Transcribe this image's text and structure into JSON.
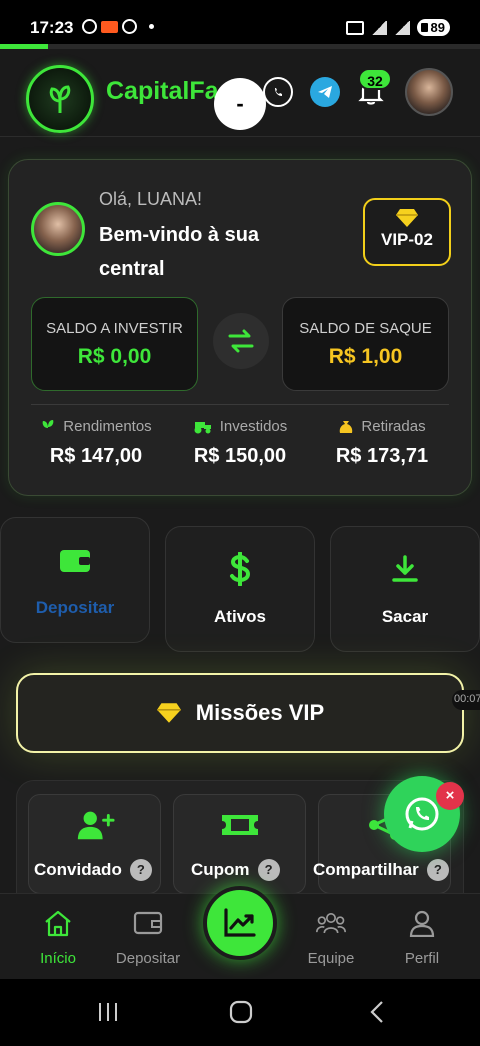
{
  "status_bar": {
    "time": "17:23",
    "battery": "89"
  },
  "loading": {
    "progress": 0.1
  },
  "header": {
    "brand": "CapitalFa",
    "notification_count": "32",
    "cursor_glyph": "-"
  },
  "welcome": {
    "greeting": "Olá, LUANA!",
    "title": "Bem-vindo à sua central",
    "vip_level": "VIP-02",
    "balances": {
      "invest_label": "SALDO A INVESTIR",
      "invest_value": "R$ 0,00",
      "saque_label": "SALDO DE SAQUE",
      "saque_value": "R$ 1,00"
    },
    "stats": [
      {
        "label": "Rendimentos",
        "value": "R$ 147,00",
        "icon": "sprout-icon"
      },
      {
        "label": "Investidos",
        "value": "R$ 150,00",
        "icon": "tractor-icon"
      },
      {
        "label": "Retiradas",
        "value": "R$ 173,71",
        "icon": "money-bag-icon"
      }
    ]
  },
  "actions": [
    {
      "label": "Depositar",
      "icon": "wallet-icon"
    },
    {
      "label": "Ativos",
      "icon": "dollar-icon"
    },
    {
      "label": "Sacar",
      "icon": "download-icon"
    }
  ],
  "missions": {
    "label": "Missões VIP",
    "edge_time": "00:07"
  },
  "mini_cards": [
    {
      "label": "Convidado",
      "icon": "add-user-icon"
    },
    {
      "label": "Cupom",
      "icon": "ticket-icon"
    },
    {
      "label": "Compartilhar",
      "icon": "share-icon"
    }
  ],
  "help_glyph": "?",
  "whatsapp_float": {
    "close_glyph": "×"
  },
  "bottom_nav": {
    "items": [
      {
        "label": "Início",
        "icon": "home-icon",
        "active": true
      },
      {
        "label": "Depositar",
        "icon": "wallet-icon"
      },
      {
        "label": "Equipe",
        "icon": "team-icon"
      },
      {
        "label": "Perfil",
        "icon": "user-icon"
      }
    ],
    "center_icon": "chart-trend-icon"
  },
  "colors": {
    "accent": "#3ee63a",
    "gold": "#f6c521",
    "vip_border": "#f2cf1a",
    "background": "#1b1b1b"
  }
}
